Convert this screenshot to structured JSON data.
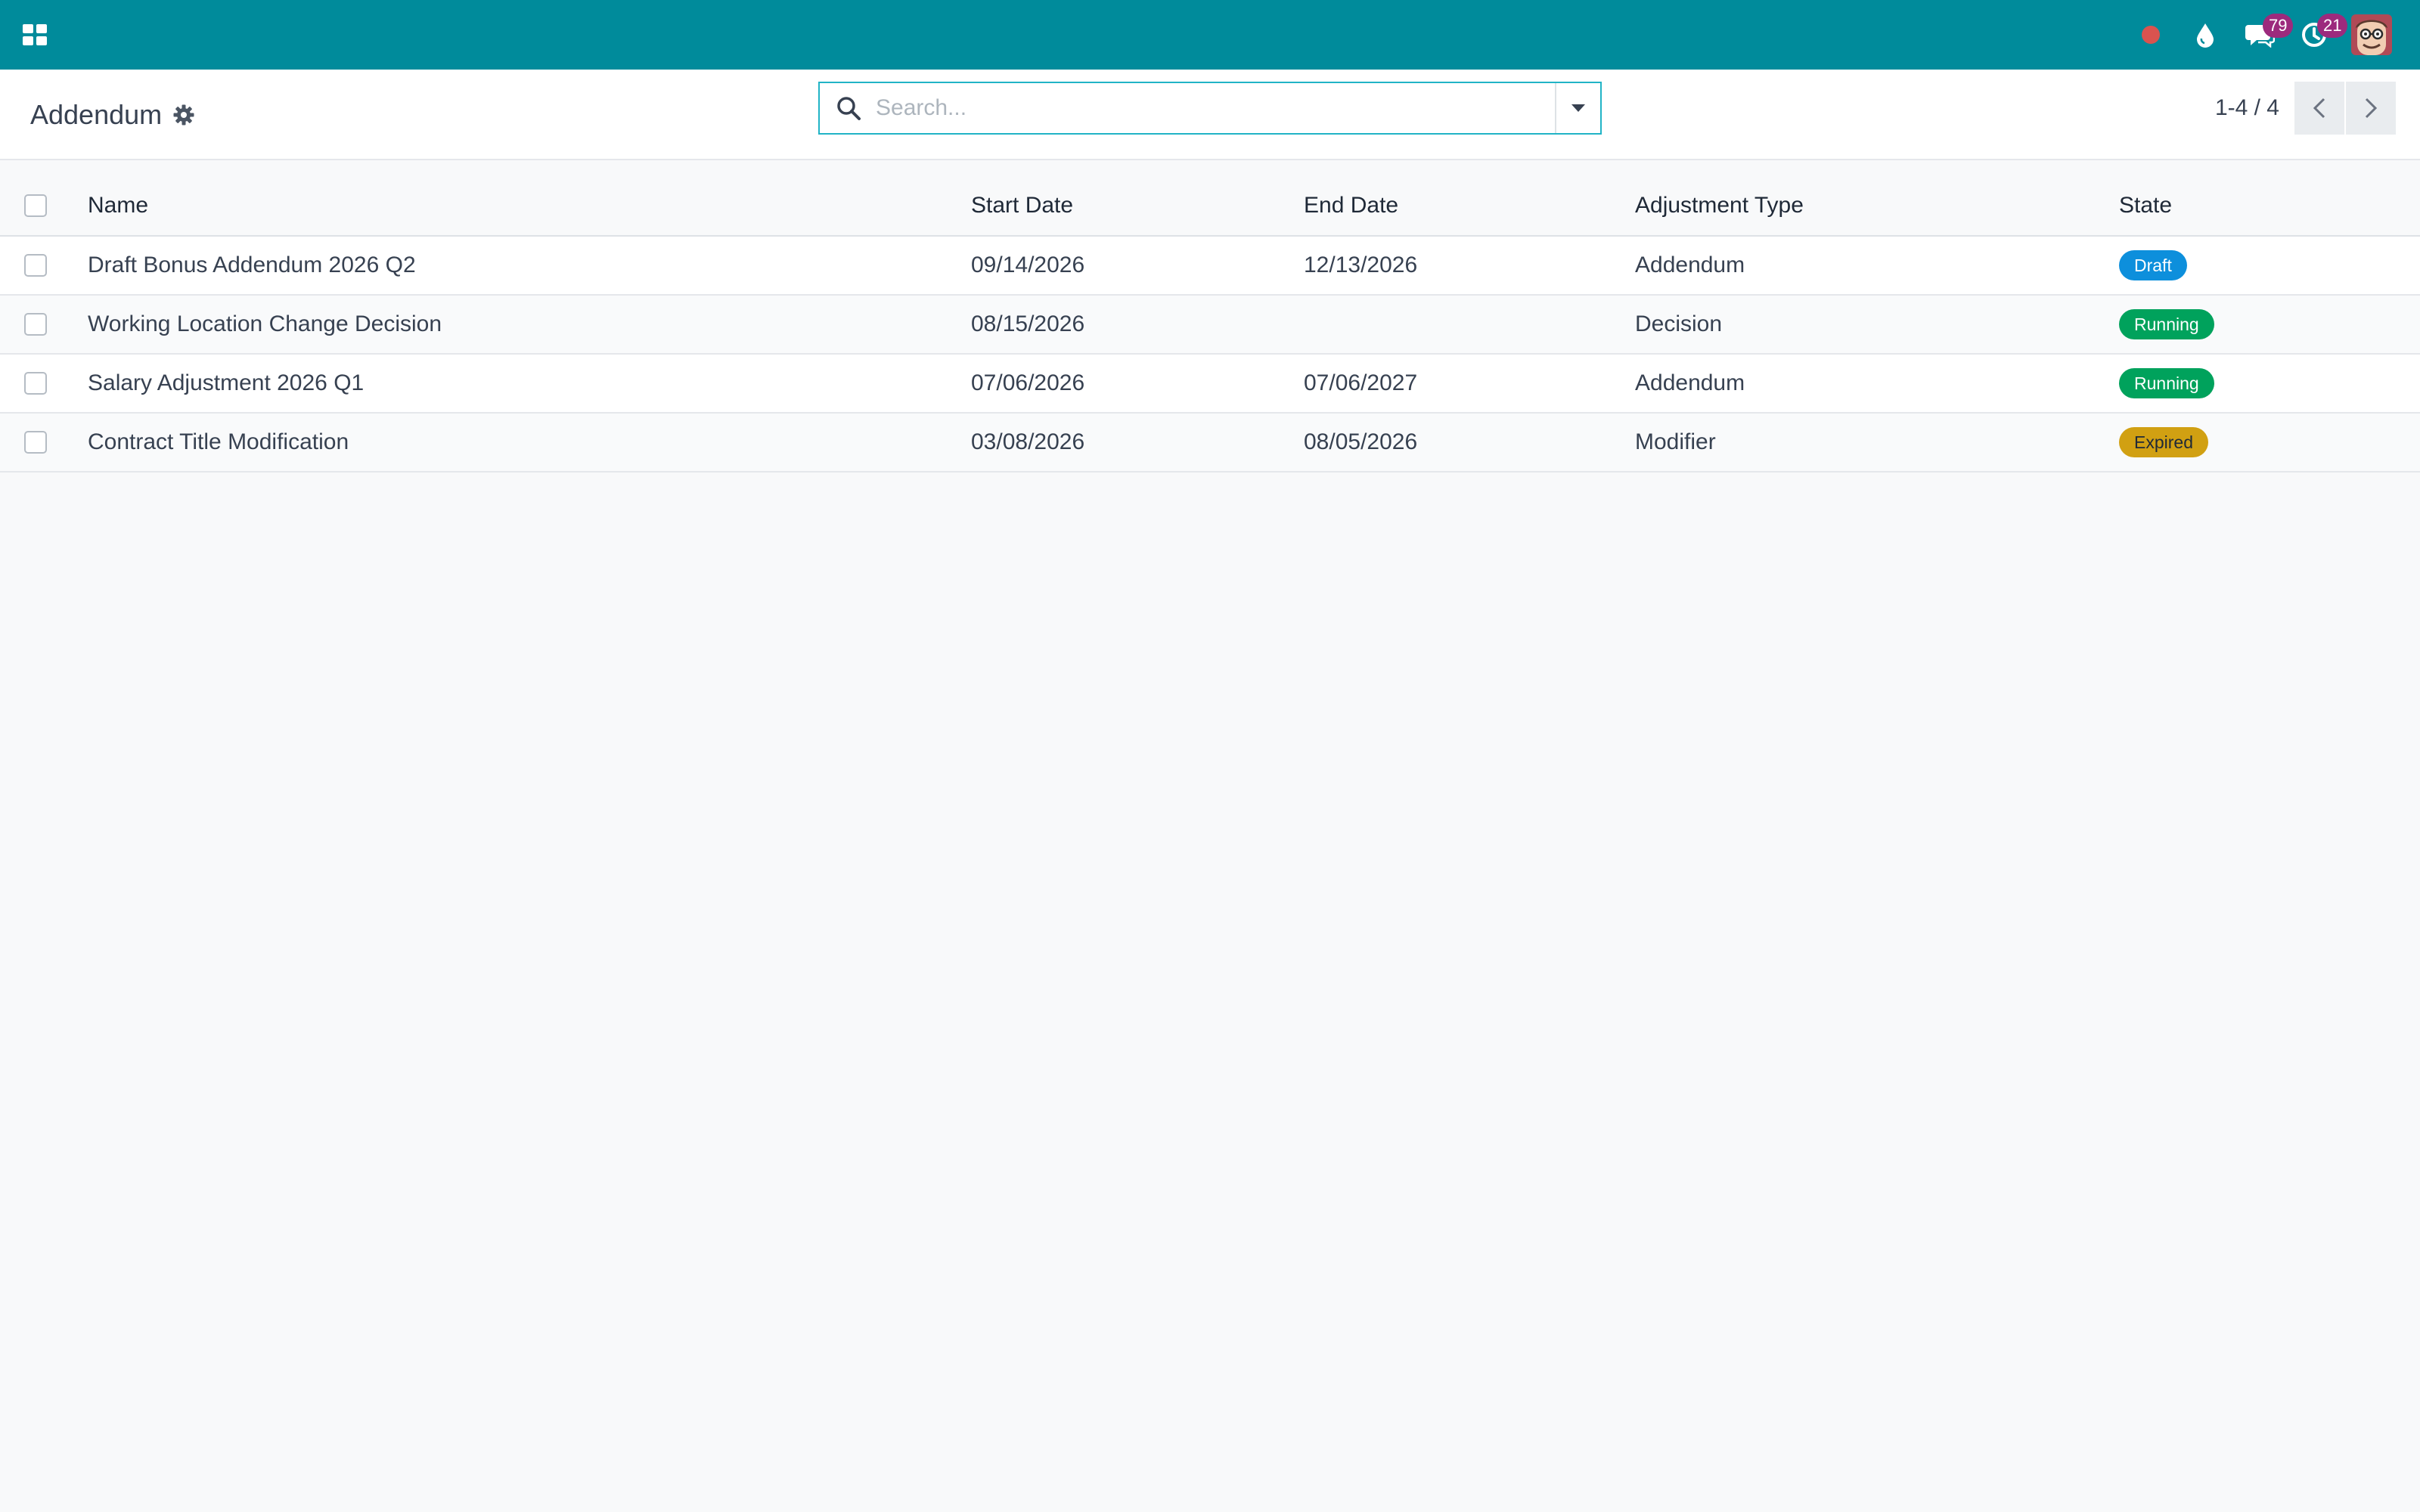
{
  "navbar": {
    "bg": "#008b9b",
    "apps_icon": "grid-icon",
    "items": [
      {
        "icon": "record-dot-icon",
        "color": "#d9534f"
      },
      {
        "icon": "droplet-icon"
      },
      {
        "icon": "chat-icon",
        "badge": "79",
        "badge_color": "#9c2a7d"
      },
      {
        "icon": "clock-icon",
        "badge": "21",
        "badge_color": "#9c2a7d"
      }
    ],
    "avatar": "user-avatar"
  },
  "control_panel": {
    "title": "Addendum",
    "search": {
      "placeholder": "Search...",
      "value": ""
    },
    "pager": {
      "value": "1-4 / 4"
    }
  },
  "table": {
    "columns": [
      "Name",
      "Start Date",
      "End Date",
      "Adjustment Type",
      "State"
    ],
    "rows": [
      {
        "name": "Draft Bonus Addendum 2026 Q2",
        "start": "09/14/2026",
        "end": "12/13/2026",
        "type": "Addendum",
        "state": "Draft",
        "state_color": "#0d8fdc",
        "dark_text": false
      },
      {
        "name": "Working Location Change Decision",
        "start": "08/15/2026",
        "end": "",
        "type": "Decision",
        "state": "Running",
        "state_color": "#00a25c",
        "dark_text": false
      },
      {
        "name": "Salary Adjustment 2026 Q1",
        "start": "07/06/2026",
        "end": "07/06/2027",
        "type": "Addendum",
        "state": "Running",
        "state_color": "#00a25c",
        "dark_text": false
      },
      {
        "name": "Contract Title Modification",
        "start": "03/08/2026",
        "end": "08/05/2026",
        "type": "Modifier",
        "state": "Expired",
        "state_color": "#d1a012",
        "dark_text": true
      }
    ]
  }
}
